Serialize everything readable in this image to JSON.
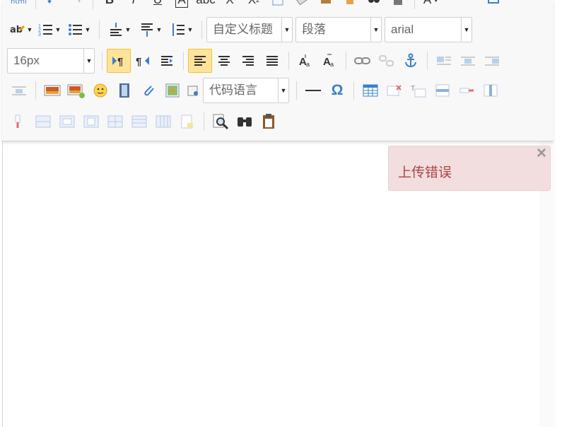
{
  "toolbar": {
    "rows": [
      {
        "items": [
          "source-html",
          "undo",
          "redo",
          "bold",
          "italic",
          "underline",
          "font-border",
          "strikethrough",
          "subscript",
          "superscript",
          "format-match",
          "eraser",
          "blockquote",
          "paste-text",
          "select-all",
          "auto-layout",
          "text-color",
          "background-color"
        ]
      },
      {
        "items": [
          "spellcheck",
          "ordered-list",
          "unordered-list",
          "row-spacing-top",
          "row-spacing-bottom",
          "line-height"
        ]
      },
      {
        "items": [
          "font-size",
          "direction-ltr",
          "direction-rtl",
          "indent",
          "align-left",
          "align-center",
          "align-right",
          "justify",
          "to-uppercase",
          "to-lowercase",
          "link",
          "unlink",
          "anchor",
          "image-none",
          "image-left",
          "image-right"
        ]
      },
      {
        "items": [
          "image-center",
          "simple-upload",
          "insert-image",
          "emotion",
          "insert-video",
          "attachment",
          "map",
          "insert-code",
          "horizontal-rule",
          "special-chars",
          "insert-table",
          "delete-table",
          "insert-caption",
          "insert-row",
          "delete-row",
          "insert-col"
        ]
      },
      {
        "items": [
          "delete-col",
          "merge-cells",
          "merge-right",
          "merge-down",
          "split-to-cells",
          "split-to-rows",
          "split-to-cols",
          "template",
          "search-replace",
          "preview",
          "paste-plain"
        ]
      }
    ],
    "custom_title": "自定义标题",
    "paragraph": "段落",
    "font_family": "arial",
    "font_size": "16px",
    "code_language": "代码语言",
    "colors": {
      "active_bg": "#ffe39a",
      "blue_icon": "#3b7fc8",
      "toast_bg": "#f2dede",
      "toast_text": "#a94442"
    }
  },
  "toast": {
    "message": "上传错误",
    "close_symbol": "×"
  }
}
